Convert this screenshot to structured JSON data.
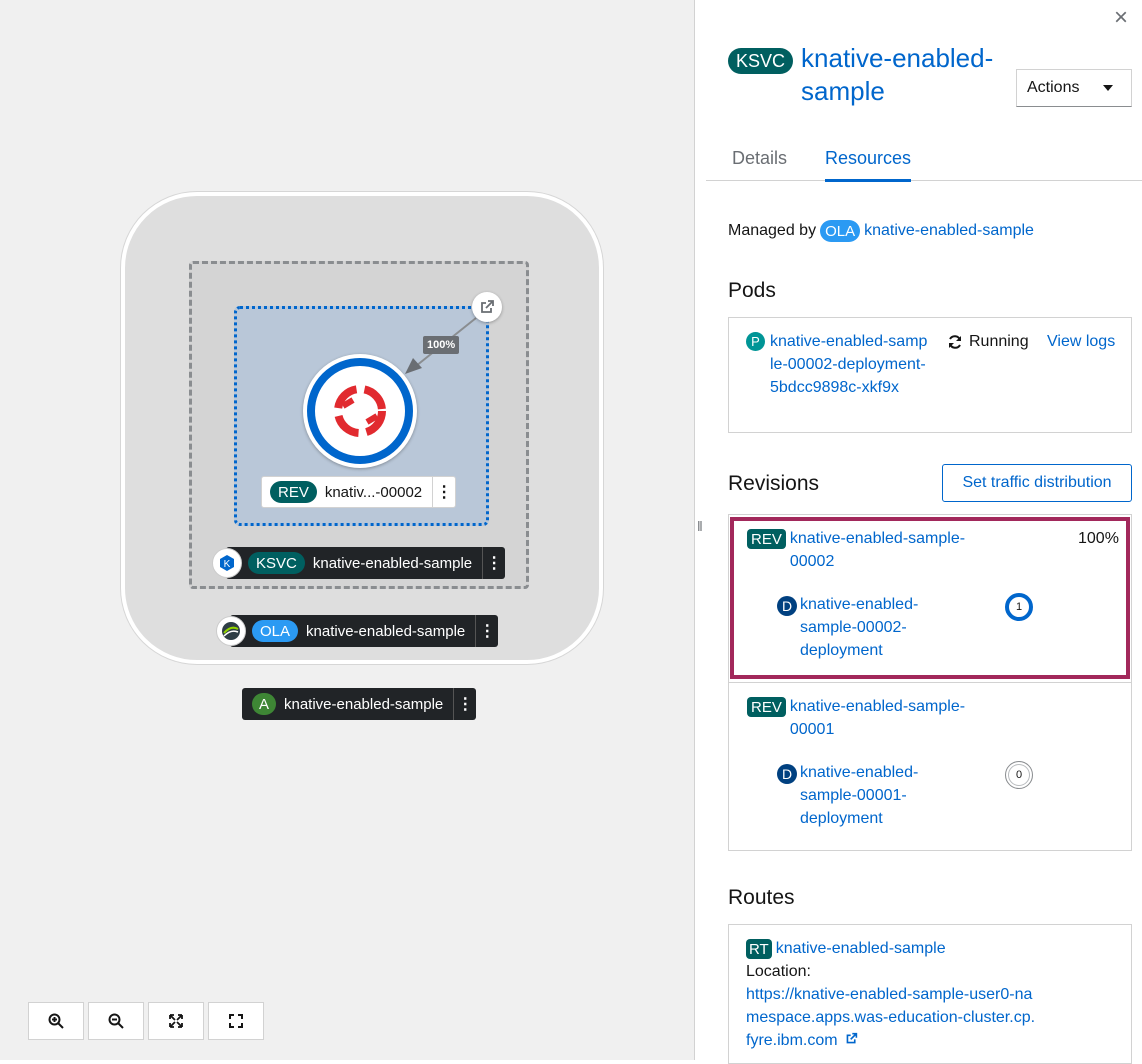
{
  "canvas": {
    "traffic_percent": "100%",
    "revision_node": {
      "badge": "REV",
      "label": "knativ...-00002"
    },
    "ksvc_node": {
      "badge": "KSVC",
      "label": "knative-enabled-sample"
    },
    "ola_node": {
      "badge": "OLA",
      "label": "knative-enabled-sample"
    },
    "app_node": {
      "badge": "A",
      "label": "knative-enabled-sample"
    },
    "kebab": "⋮",
    "zoom_controls": [
      "zoom-in-icon",
      "zoom-out-icon",
      "fit-to-screen-icon",
      "reset-view-icon"
    ]
  },
  "panel": {
    "close": "×",
    "badge": "KSVC",
    "title": "knative-enabled-sample",
    "actions_label": "Actions",
    "tabs": [
      {
        "label": "Details",
        "active": false
      },
      {
        "label": "Resources",
        "active": true
      }
    ],
    "managed_by": {
      "prefix": "Managed by",
      "badge": "OLA",
      "link": "knative-enabled-sample"
    },
    "pods": {
      "heading": "Pods",
      "items": [
        {
          "badge": "P",
          "name": "knative-enabled-sample-00002-deployment-5bdcc9898c-xkf9x",
          "status": "Running",
          "action": "View logs"
        }
      ]
    },
    "revisions": {
      "heading": "Revisions",
      "button": "Set traffic distribution",
      "items": [
        {
          "badge": "REV",
          "name": "knative-enabled-sample-00002",
          "traffic": "100%",
          "deployment": {
            "badge": "D",
            "name": "knative-enabled-sample-00002-deployment",
            "pod_count": "1"
          }
        },
        {
          "badge": "REV",
          "name": "knative-enabled-sample-00001",
          "traffic": "",
          "deployment": {
            "badge": "D",
            "name": "knative-enabled-sample-00001-deployment",
            "pod_count": "0"
          }
        }
      ]
    },
    "routes": {
      "heading": "Routes",
      "items": [
        {
          "badge": "RT",
          "name": "knative-enabled-sample",
          "location_label": "Location:",
          "url": "https://knative-enabled-sample-user0-namespace.apps.was-education-cluster.cp.fyre.ibm.com"
        }
      ]
    }
  },
  "colors": {
    "link": "#0066cc",
    "teal_badge": "#005f60",
    "ola_badge": "#2b9af3",
    "highlight_border": "#a2285b"
  }
}
